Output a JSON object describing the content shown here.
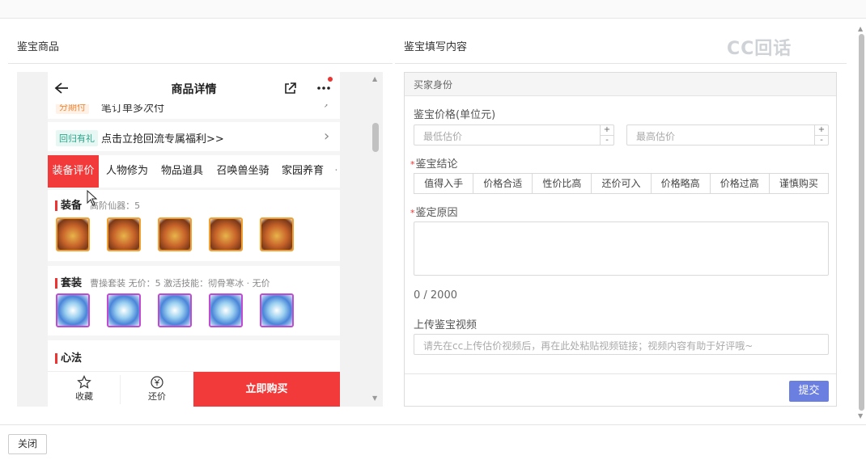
{
  "left_section": {
    "title": "鉴宝商品"
  },
  "right_section": {
    "title": "鉴宝填写内容"
  },
  "watermark": "CC回话",
  "phone": {
    "header_title": "商品详情",
    "promo_row_1": {
      "tag": "分期付",
      "text": "笔订单多次付"
    },
    "promo_row_2": {
      "tag": "回归有礼",
      "text": "点击立抢回流专属福利>>"
    },
    "tabs": [
      "装备评价",
      "人物修为",
      "物品道具",
      "召唤兽坐骑",
      "家园养育"
    ],
    "equip_card": {
      "title": "装备",
      "sub": "高阶仙器：5"
    },
    "suit_card": {
      "title": "套装",
      "sub": "曹操套装  无价：5  激活技能：彻骨寒冰 · 无价"
    },
    "xinfa_card": {
      "title": "心法"
    },
    "bottom": {
      "favorite": "收藏",
      "bargain": "还价",
      "buy": "立即购买"
    }
  },
  "form": {
    "header": "买家身份",
    "price_label": "鉴宝价格(单位元)",
    "min_placeholder": "最低估价",
    "max_placeholder": "最高估价",
    "conclusion_label": "鉴宝结论",
    "conclusion_options": [
      "值得入手",
      "价格合适",
      "性价比高",
      "还价可入",
      "价格略高",
      "价格过高",
      "谨慎购买"
    ],
    "reason_label": "鉴定原因",
    "char_count": "0 / 2000",
    "video_label": "上传鉴宝视频",
    "video_placeholder": "请先在cc上传估价视频后，再在此处粘贴视频链接；视频内容有助于好评哦~",
    "submit": "提交"
  },
  "footer": {
    "close": "关闭"
  },
  "colors": {
    "accent_red": "#f23a3a",
    "submit_blue": "#6b7fe0"
  },
  "icons": [
    "back-arrow-icon",
    "share-icon",
    "more-icon",
    "star-icon",
    "yen-icon",
    "cursor-icon"
  ]
}
